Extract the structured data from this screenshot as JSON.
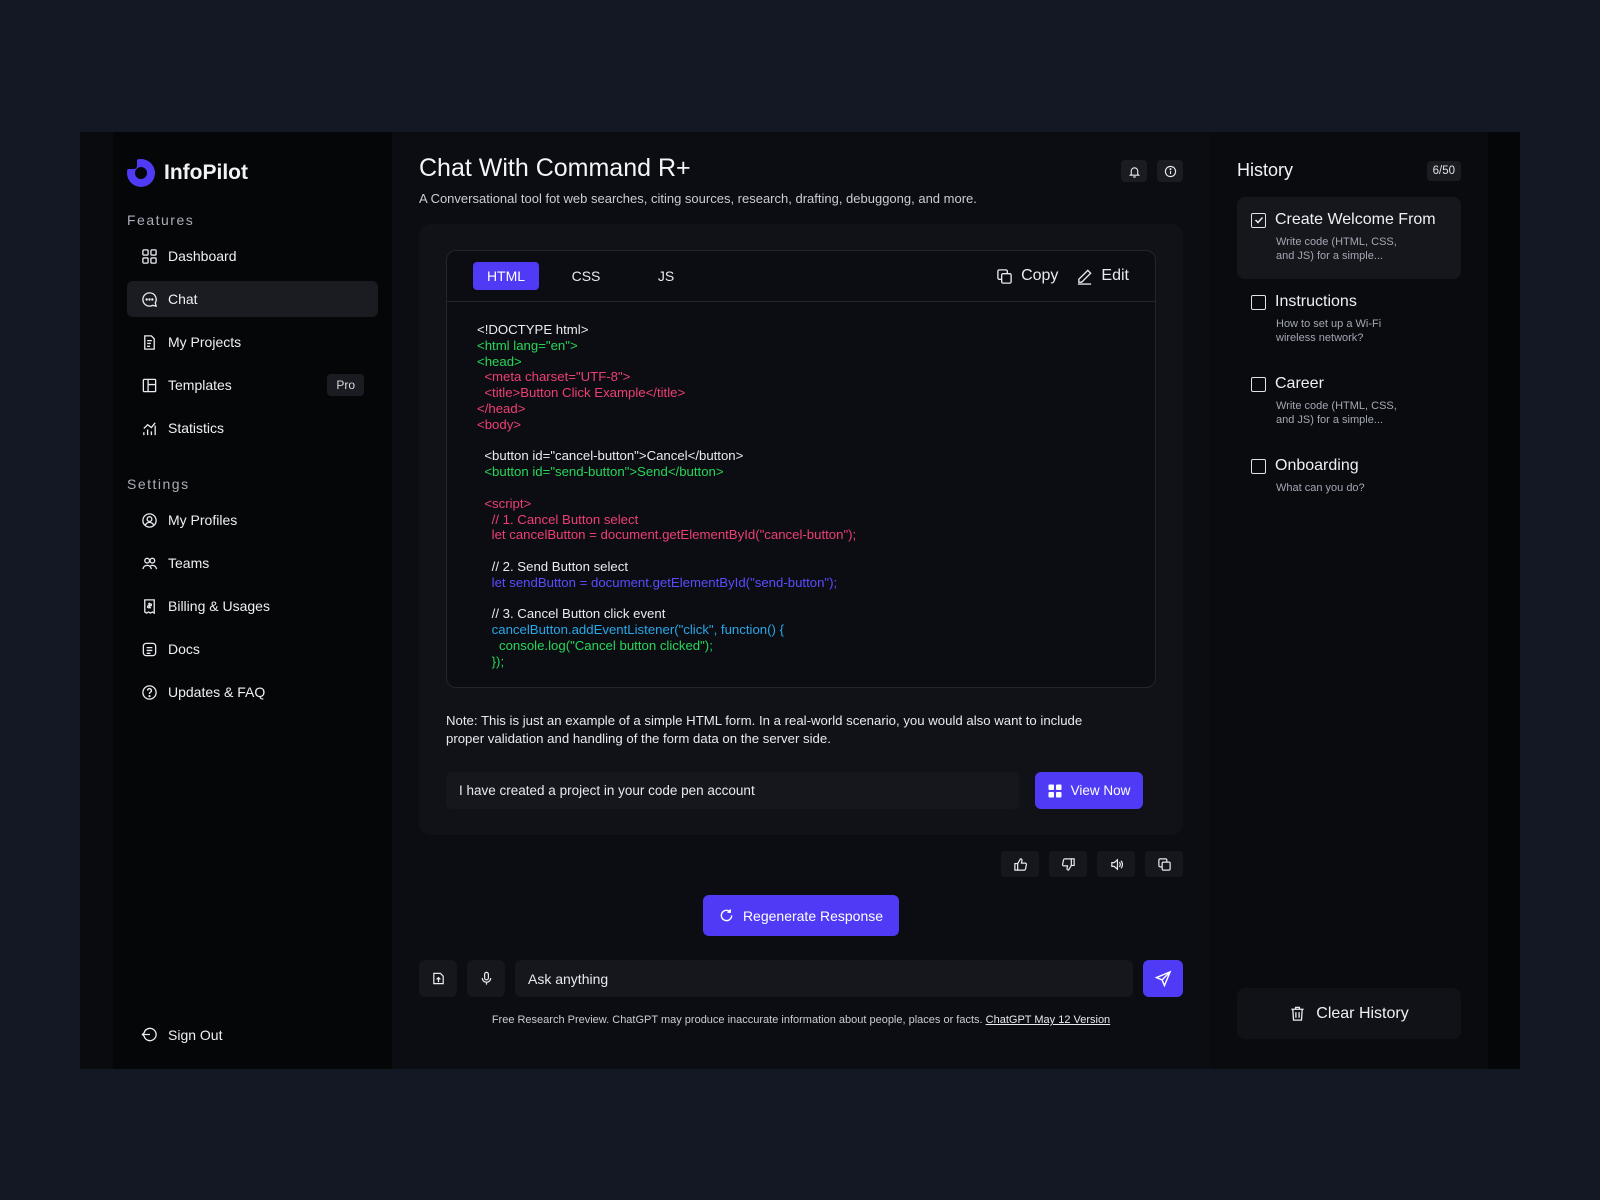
{
  "brand": {
    "name": "InfoPilot",
    "accent": "#4f3bf5"
  },
  "sidebar": {
    "features_label": "Features",
    "features": [
      {
        "label": "Dashboard",
        "icon": "dashboard-icon"
      },
      {
        "label": "Chat",
        "icon": "chat-icon"
      },
      {
        "label": "My Projects",
        "icon": "projects-icon"
      },
      {
        "label": "Templates",
        "icon": "templates-icon",
        "badge": "Pro"
      },
      {
        "label": "Statistics",
        "icon": "statistics-icon"
      }
    ],
    "settings_label": "Settings",
    "settings": [
      {
        "label": "My Profiles",
        "icon": "profile-icon"
      },
      {
        "label": "Teams",
        "icon": "teams-icon"
      },
      {
        "label": "Billing & Usages",
        "icon": "billing-icon"
      },
      {
        "label": "Docs",
        "icon": "docs-icon"
      },
      {
        "label": "Updates & FAQ",
        "icon": "help-icon"
      }
    ],
    "signout": "Sign Out"
  },
  "main": {
    "title": "Chat With Command R+",
    "subtitle": "A Conversational tool fot web searches, citing sources, research, drafting, debuggong, and more.",
    "tabs": [
      "HTML",
      "CSS",
      "JS"
    ],
    "copy_label": "Copy",
    "edit_label": "Edit",
    "code_lines": [
      {
        "text": "<!DOCTYPE html>",
        "color": "w"
      },
      {
        "text": "<html lang=\"en\">",
        "color": "g"
      },
      {
        "text": "<head>",
        "color": "g"
      },
      {
        "text": "  <meta charset=\"UTF-8\">",
        "color": "p"
      },
      {
        "text": "  <title>Button Click Example</title>",
        "color": "p"
      },
      {
        "text": "</head>",
        "color": "p"
      },
      {
        "text": "<body>",
        "color": "p"
      },
      {
        "text": "",
        "color": "w"
      },
      {
        "text": "  <button id=\"cancel-button\">Cancel</button>",
        "color": "w"
      },
      {
        "text": "  <button id=\"send-button\">Send</button>",
        "color": "g"
      },
      {
        "text": "",
        "color": "w"
      },
      {
        "text": "  <script>",
        "color": "p"
      },
      {
        "text": "    // 1. Cancel Button select",
        "color": "p"
      },
      {
        "text": "    let cancelButton = document.getElementById(\"cancel-button\");",
        "color": "p"
      },
      {
        "text": "",
        "color": "w"
      },
      {
        "text": "    // 2. Send Button select",
        "color": "w"
      },
      {
        "text": "    let sendButton = document.getElementById(\"send-button\");",
        "color": "b"
      },
      {
        "text": "",
        "color": "w"
      },
      {
        "text": "    // 3. Cancel Button click event",
        "color": "w"
      },
      {
        "text": "    cancelButton.addEventListener(\"click\", function() {",
        "color": "c"
      },
      {
        "text": "      console.log(\"Cancel button clicked\");",
        "color": "g"
      },
      {
        "text": "    });",
        "color": "g"
      }
    ],
    "note": "Note: This is just an example of a simple HTML form. In a real-world scenario, you would also want to include proper validation and handling of the form data on the server side.",
    "project_text": "I have created a project in your code pen account",
    "view_now": "View Now",
    "regenerate": "Regenerate Response",
    "ask_placeholder": "Ask anything",
    "disclaimer": "Free Research Preview. ChatGPT may produce inaccurate information about people, places or facts.",
    "disclaimer_link": "ChatGPT May 12 Version"
  },
  "history": {
    "title": "History",
    "count": "6/50",
    "items": [
      {
        "title": "Create Welcome From",
        "desc": "Write code (HTML, CSS, and JS) for a simple...",
        "checked": true
      },
      {
        "title": "Instructions",
        "desc": "How to set up a Wi-Fi wireless network?",
        "checked": false
      },
      {
        "title": "Career",
        "desc": "Write code (HTML, CSS, and JS) for a simple...",
        "checked": false
      },
      {
        "title": "Onboarding",
        "desc": "What can you do?",
        "checked": false
      }
    ],
    "clear_label": "Clear History"
  }
}
